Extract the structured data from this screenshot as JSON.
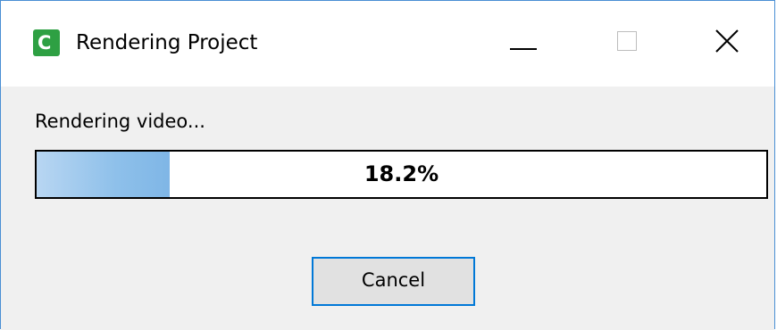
{
  "window": {
    "title": "Rendering Project",
    "app_icon_glyph": "C",
    "icons": {
      "app": "camtasia-app-icon",
      "minimize": "minimize-icon",
      "maximize": "maximize-icon",
      "close": "close-icon"
    }
  },
  "status": {
    "text": "Rendering video..."
  },
  "progress": {
    "percent": 18.2,
    "label": "18.2%"
  },
  "buttons": {
    "cancel_label": "Cancel"
  },
  "colors": {
    "accent": "#0078d7",
    "app_icon": "#2ea043",
    "progress_fill": "#8ec0ea"
  }
}
